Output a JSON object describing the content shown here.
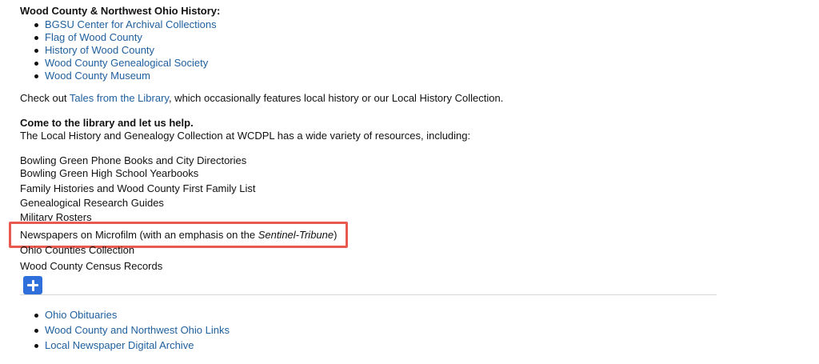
{
  "wood_county": {
    "heading": "Wood County & Northwest Ohio History:",
    "links": [
      "BGSU Center for Archival Collections",
      "Flag of Wood County",
      "History of Wood County",
      "Wood County Genealogical Society",
      "Wood County Museum"
    ]
  },
  "tales": {
    "prefix": "Check out ",
    "link": "Tales from the Library",
    "suffix": ", which occasionally features local history or our Local History Collection."
  },
  "library": {
    "heading": "Come to the library and let us help.",
    "intro": "The Local History and Genealogy Collection at WCDPL has a wide variety of resources, including:"
  },
  "resources": [
    "Bowling Green Phone Books and City Directories",
    "Bowling Green High School Yearbooks",
    "Family Histories and Wood County First Family List",
    "Genealogical Research Guides",
    "Military Rosters"
  ],
  "highlighted": {
    "prefix": "Newspapers on Microfilm (with an emphasis on the ",
    "italic": "Sentinel-Tribune",
    "suffix": ")"
  },
  "resources_after": [
    "Ohio Counties Collection",
    "Wood County Census Records"
  ],
  "expand_button": {
    "icon": "plus-icon"
  },
  "bottom_links": [
    "Ohio Obituaries",
    "Wood County and Northwest Ohio Links",
    "Local Newspaper Digital Archive"
  ],
  "colors": {
    "link": "#1f5f9e",
    "highlight_border": "#e8594f",
    "button": "#2f6fdb"
  }
}
